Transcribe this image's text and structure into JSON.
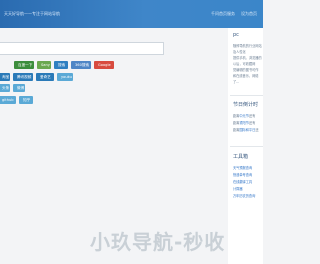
{
  "header": {
    "site_title": "天天好导航——专注于网站导航",
    "top_links": [
      "千问首页服务",
      "设为首页"
    ]
  },
  "search": {
    "placeholder": ""
  },
  "engine_buttons": [
    {
      "label": "百度一下",
      "color": "#3c8d3c"
    },
    {
      "label": "Sany",
      "color": "#6aa84f"
    },
    {
      "label": "搜索",
      "color": "#2f7fc1"
    },
    {
      "label": "360搜索",
      "color": "#4f86c6"
    },
    {
      "label": "Google",
      "color": "#d84b3f"
    }
  ],
  "row2_buttons": [
    {
      "label": "淘宝",
      "color": "#2a7ab8"
    },
    {
      "label": "腾讯视频",
      "color": "#2a7ab8"
    },
    {
      "label": "爱奇艺",
      "color": "#2a7ab8"
    },
    {
      "label": "youku",
      "color": "#5aa9d6"
    }
  ],
  "row3_buttons": [
    {
      "label": "头条",
      "color": "#5aa9d6"
    },
    {
      "label": "微博",
      "color": "#5aa9d6"
    }
  ],
  "row4_buttons": [
    {
      "label": "github",
      "color": "#5aa9d6"
    },
    {
      "label": "知乎",
      "color": "#5aa9d6"
    }
  ],
  "sidebar": {
    "card1": {
      "title": "pc",
      "lines": [
        "随即导航的行业网站",
        "及人性化",
        "提供手机、浏览器的",
        "以后，可收藏网",
        "觉编辑的图书可作",
        "和在线音乐，网络",
        "了..."
      ]
    },
    "card2": {
      "title": "节日倒计时",
      "lines": [
        {
          "prefix": "距离",
          "link": "中元节",
          "suffix": "还有"
        },
        {
          "prefix": "距离",
          "link": "重阳节",
          "suffix": "还有"
        },
        {
          "prefix": "距离",
          "link": "国际和平日",
          "suffix": "还"
        }
      ]
    },
    "card3": {
      "title": "工具箱",
      "lines": [
        "天气预报查询",
        "快递单号查询",
        "在线翻译工具",
        "计算器",
        "万年历农历查询"
      ]
    }
  },
  "watermark": "小玖导航-秒收"
}
